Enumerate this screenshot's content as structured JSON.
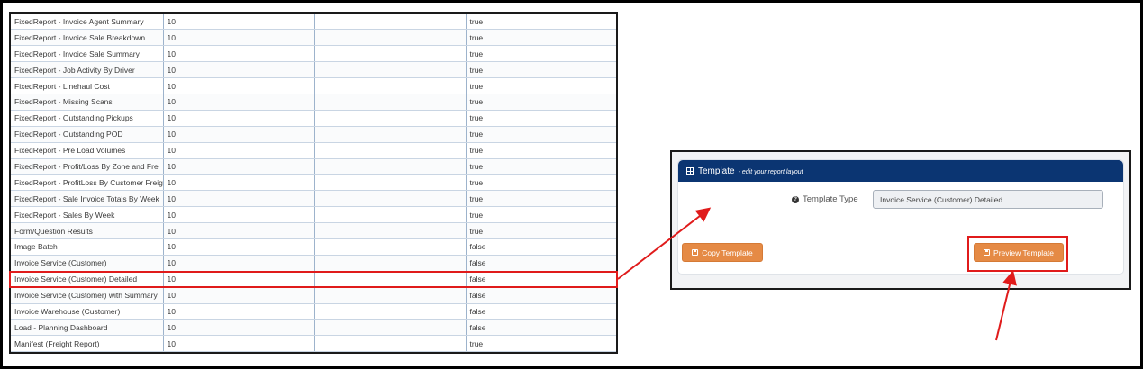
{
  "table": {
    "rows": [
      {
        "name": "FixedReport - Invoice Agent Summary",
        "count": "10",
        "blank": "",
        "flag": "true"
      },
      {
        "name": "FixedReport - Invoice Sale Breakdown",
        "count": "10",
        "blank": "",
        "flag": "true"
      },
      {
        "name": "FixedReport - Invoice Sale Summary",
        "count": "10",
        "blank": "",
        "flag": "true"
      },
      {
        "name": "FixedReport - Job Activity By Driver",
        "count": "10",
        "blank": "",
        "flag": "true"
      },
      {
        "name": "FixedReport - Linehaul Cost",
        "count": "10",
        "blank": "",
        "flag": "true"
      },
      {
        "name": "FixedReport - Missing Scans",
        "count": "10",
        "blank": "",
        "flag": "true"
      },
      {
        "name": "FixedReport - Outstanding Pickups",
        "count": "10",
        "blank": "",
        "flag": "true"
      },
      {
        "name": "FixedReport - Outstanding POD",
        "count": "10",
        "blank": "",
        "flag": "true"
      },
      {
        "name": "FixedReport - Pre Load Volumes",
        "count": "10",
        "blank": "",
        "flag": "true"
      },
      {
        "name": "FixedReport - Profit/Loss By Zone and Frei",
        "count": "10",
        "blank": "",
        "flag": "true"
      },
      {
        "name": "FixedReport - ProfitLoss By Customer Freig",
        "count": "10",
        "blank": "",
        "flag": "true"
      },
      {
        "name": "FixedReport - Sale Invoice Totals By Week",
        "count": "10",
        "blank": "",
        "flag": "true"
      },
      {
        "name": "FixedReport - Sales By Week",
        "count": "10",
        "blank": "",
        "flag": "true"
      },
      {
        "name": "Form/Question Results",
        "count": "10",
        "blank": "",
        "flag": "true"
      },
      {
        "name": "Image Batch",
        "count": "10",
        "blank": "",
        "flag": "false"
      },
      {
        "name": "Invoice Service (Customer)",
        "count": "10",
        "blank": "",
        "flag": "false"
      },
      {
        "name": "Invoice Service (Customer) Detailed",
        "count": "10",
        "blank": "",
        "flag": "false"
      },
      {
        "name": "Invoice Service (Customer) with Summary",
        "count": "10",
        "blank": "",
        "flag": "false"
      },
      {
        "name": "Invoice Warehouse (Customer)",
        "count": "10",
        "blank": "",
        "flag": "false"
      },
      {
        "name": "Load - Planning Dashboard",
        "count": "10",
        "blank": "",
        "flag": "false"
      },
      {
        "name": "Manifest (Freight Report)",
        "count": "10",
        "blank": "",
        "flag": "true"
      }
    ]
  },
  "template_panel": {
    "title": "Template",
    "subtitle": "- edit your report layout",
    "header_icon": "table-icon",
    "field_label": "Template Type",
    "field_icon": "question-circle-icon",
    "field_value": "Invoice Service (Customer) Detailed",
    "copy_button": "Copy Template",
    "preview_button": "Preview Template",
    "button_icon": "save-icon",
    "button_color": "#e58a45",
    "header_color": "#0b3572"
  },
  "annotations": {
    "highlight_color": "#e01b1b"
  }
}
